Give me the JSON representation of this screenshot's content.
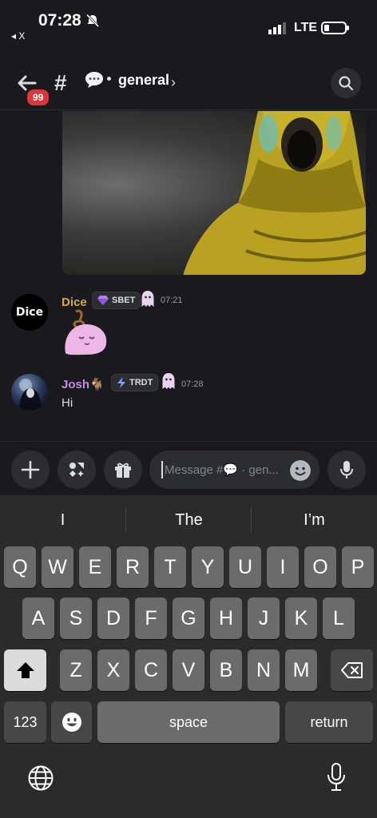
{
  "status_bar": {
    "time": "07:28",
    "back_app_label": "◂ X",
    "network": "LTE"
  },
  "header": {
    "unread_badge": "99",
    "hash_symbol": "#",
    "channel_name": "general",
    "chevron": "›",
    "icons": [
      "back-arrow-icon",
      "speech-bubble-icon",
      "search-icon"
    ]
  },
  "messages": [
    {
      "author": "Dice",
      "avatar_text": "Dice",
      "author_color": "#d4a94c",
      "tag": "SBET",
      "tag_icon": "gem-icon",
      "time": "07:21",
      "content_type": "sticker"
    },
    {
      "author": "Josh🐐",
      "author_color": "#c98be6",
      "tag": "TRDT",
      "tag_icon": "lightning-icon",
      "time": "07:28",
      "text": "Hi"
    }
  ],
  "composer": {
    "placeholder": "Message #💬 · gen...",
    "buttons": [
      "plus-icon",
      "apps-icon",
      "gift-icon",
      "emoji-icon",
      "mic-icon"
    ]
  },
  "keyboard": {
    "suggestions": [
      "I",
      "The",
      "I’m"
    ],
    "row1": [
      "Q",
      "W",
      "E",
      "R",
      "T",
      "Y",
      "U",
      "I",
      "O",
      "P"
    ],
    "row2": [
      "A",
      "S",
      "D",
      "F",
      "G",
      "H",
      "J",
      "K",
      "L"
    ],
    "row3": [
      "Z",
      "X",
      "C",
      "V",
      "B",
      "N",
      "M"
    ],
    "numbers_key": "123",
    "space_key": "space",
    "return_key": "return"
  },
  "colors": {
    "background": "#1a1a1e",
    "badge": "#da373c",
    "dice_name": "#d4a94c",
    "josh_name": "#c98be6"
  }
}
